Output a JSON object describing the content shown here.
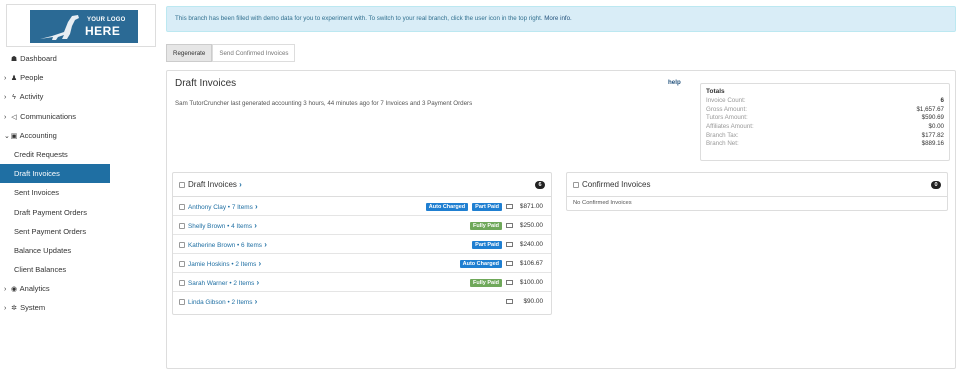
{
  "logo": {
    "line1": "YOUR LOGO",
    "line2": "HERE"
  },
  "sidebar": {
    "items": [
      {
        "label": "Dashboard",
        "icon": "tachometer-icon",
        "glyph": "☗",
        "caret": ""
      },
      {
        "label": "People",
        "icon": "user-icon",
        "glyph": "♟",
        "caret": "›"
      },
      {
        "label": "Activity",
        "icon": "activity-icon",
        "glyph": "ϟ",
        "caret": "›"
      },
      {
        "label": "Communications",
        "icon": "bullhorn-icon",
        "glyph": "◁",
        "caret": "›"
      },
      {
        "label": "Accounting",
        "icon": "money-icon",
        "glyph": "▣",
        "caret": "⌄"
      },
      {
        "label": "Credit Requests"
      },
      {
        "label": "Draft Invoices"
      },
      {
        "label": "Sent Invoices"
      },
      {
        "label": "Draft Payment Orders"
      },
      {
        "label": "Sent Payment Orders"
      },
      {
        "label": "Balance Updates"
      },
      {
        "label": "Client Balances"
      },
      {
        "label": "Analytics",
        "icon": "eye-icon",
        "glyph": "◉",
        "caret": "›"
      },
      {
        "label": "System",
        "icon": "cog-icon",
        "glyph": "✲",
        "caret": "›"
      }
    ]
  },
  "alert": {
    "text": "This branch has been filled with demo data for you to experiment with. To switch to your real branch, click the user icon in the top right. ",
    "link": "More info."
  },
  "tabs": [
    {
      "label": "Regenerate"
    },
    {
      "label": "Send Confirmed Invoices"
    }
  ],
  "main": {
    "title": "Draft Invoices",
    "help": "help",
    "subtitle": "Sam TutorCruncher last generated accounting 3 hours, 44 minutes ago for 7 Invoices and 3 Payment Orders"
  },
  "totals": {
    "title": "Totals",
    "rows": [
      {
        "label": "Invoice Count:",
        "value": "6"
      },
      {
        "label": "Gross Amount:",
        "value": "$1,657.67"
      },
      {
        "label": "Tutors Amount:",
        "value": "$590.69"
      },
      {
        "label": "Affiliates Amount:",
        "value": "$0.00"
      },
      {
        "label": "Branch Tax:",
        "value": "$177.82"
      },
      {
        "label": "Branch Net:",
        "value": "$889.16"
      }
    ]
  },
  "draft_panel": {
    "title": "Draft Invoices",
    "count": "6",
    "rows": [
      {
        "name": "Anthony Clay",
        "items": "7 Items",
        "badges": [
          {
            "label": "Auto Charged",
            "color": "#1f7fd1"
          },
          {
            "label": "Part Paid",
            "color": "#1f7fd1"
          }
        ],
        "amount": "$871.00"
      },
      {
        "name": "Shelly Brown",
        "items": "4 Items",
        "badges": [
          {
            "label": "Fully Paid",
            "color": "#6fa85a"
          }
        ],
        "amount": "$250.00"
      },
      {
        "name": "Katherine Brown",
        "items": "6 Items",
        "badges": [
          {
            "label": "Part Paid",
            "color": "#1f7fd1"
          }
        ],
        "amount": "$240.00"
      },
      {
        "name": "Jamie Hoskins",
        "items": "2 Items",
        "badges": [
          {
            "label": "Auto Charged",
            "color": "#1f7fd1"
          }
        ],
        "amount": "$106.67"
      },
      {
        "name": "Sarah Warner",
        "items": "2 Items",
        "badges": [
          {
            "label": "Fully Paid",
            "color": "#6fa85a"
          }
        ],
        "amount": "$100.00"
      },
      {
        "name": "Linda Gibson",
        "items": "2 Items",
        "badges": [],
        "amount": "$90.00"
      }
    ]
  },
  "confirmed_panel": {
    "title": "Confirmed Invoices",
    "count": "0",
    "empty": "No Confirmed Invoices"
  }
}
